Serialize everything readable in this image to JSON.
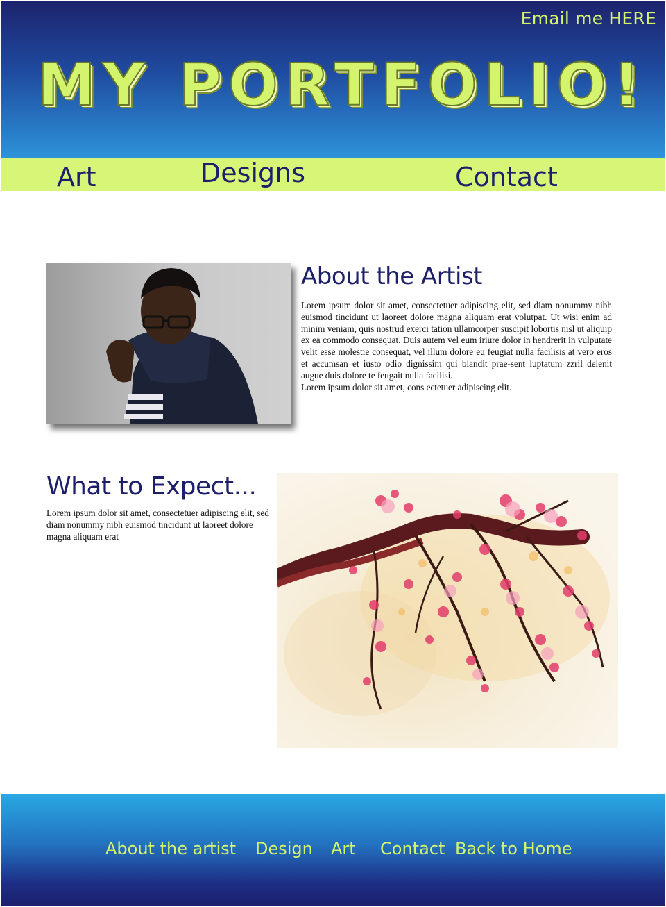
{
  "header": {
    "email_link": "Email me HERE",
    "title": "MY PORTFOLIO!"
  },
  "nav": {
    "items": [
      "Art",
      "Designs",
      "Contact"
    ]
  },
  "about": {
    "heading": "About the Artist",
    "body": "Lorem ipsum dolor sit amet, consectetuer adipiscing elit, sed diam nonummy nibh euismod tincidunt ut laoreet dolore magna aliquam erat volutpat. Ut wisi enim ad minim veniam, quis nostrud exerci tation ullamcorper suscipit lobortis nisl ut aliquip ex ea commodo consequat. Duis autem vel eum iriure dolor in hendrerit in vulputate velit esse molestie consequat, vel illum dolore eu feugiat nulla facilisis at vero eros et accumsan et iusto odio dignissim qui blandit prae-sent luptatum zzril delenit augue duis dolore te feugait nulla facilisi.",
    "body_line2": "Lorem ipsum dolor sit amet, cons ectetuer adipiscing elit."
  },
  "expect": {
    "heading": "What to Expect...",
    "body": "Lorem ipsum dolor sit amet, consectetuer adipiscing elit, sed diam nonummy nibh euismod tincidunt ut laoreet dolore magna aliquam erat"
  },
  "footer": {
    "links": [
      "About the artist",
      "Design",
      "Art",
      "Contact",
      "Back to Home"
    ]
  },
  "colors": {
    "accent_lime": "#d4f46e",
    "navy": "#1d1f6b",
    "header_blue": "#2d93d9"
  }
}
